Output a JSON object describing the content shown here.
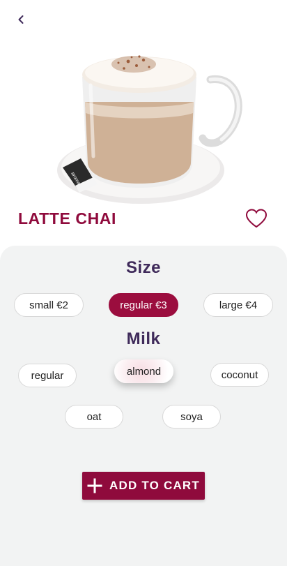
{
  "product": {
    "name": "LATTE CHAI",
    "image_icon": "latte-cup-image"
  },
  "size": {
    "title": "Size",
    "options": [
      {
        "label": "small €2",
        "selected": false
      },
      {
        "label": "regular €3",
        "selected": true
      },
      {
        "label": "large €4",
        "selected": false
      }
    ]
  },
  "milk": {
    "title": "Milk",
    "options": [
      {
        "label": "regular",
        "selected": false
      },
      {
        "label": "almond",
        "selected": true
      },
      {
        "label": "coconut",
        "selected": false
      },
      {
        "label": "oat",
        "selected": false
      },
      {
        "label": "soya",
        "selected": false
      }
    ]
  },
  "cart": {
    "label": "ADD TO CART"
  },
  "colors": {
    "brand": "#8f0a3c",
    "heading": "#3f2a5a",
    "panel": "#f2f3f3"
  },
  "icons": {
    "back": "chevron-left-icon",
    "favorite": "heart-outline-icon",
    "add": "plus-icon"
  }
}
